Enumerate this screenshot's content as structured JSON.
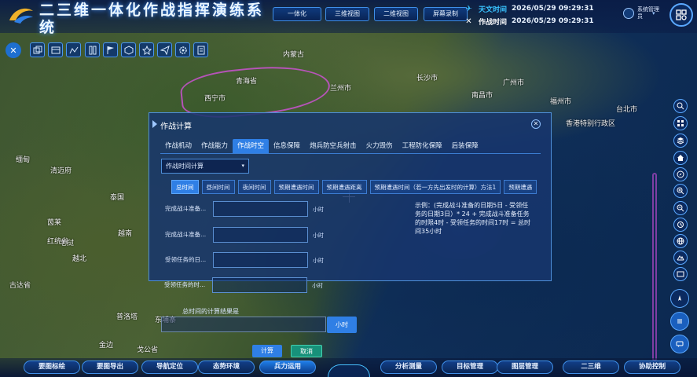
{
  "app": {
    "title": "二三维一体化作战指挥演练系统"
  },
  "top_nav": [
    {
      "label": "一体化"
    },
    {
      "label": "三维视图"
    },
    {
      "label": "二维视图"
    },
    {
      "label": "屏幕录制"
    }
  ],
  "times": {
    "astro_label": "天文时间",
    "astro_value": "2026/05/29 09:29:31",
    "op_label": "作战时间",
    "op_value": "2026/05/29 09:29:31"
  },
  "user": {
    "name": "系统管理员"
  },
  "map_labels": [
    "青海省",
    "内蒙古",
    "西宁市",
    "兰州市",
    "长沙市",
    "南昌市",
    "广州市",
    "福州市",
    "台北市",
    "香港特别行政区",
    "泰国",
    "清迈府",
    "老挝",
    "越南",
    "越北",
    "缅甸",
    "东埔寨",
    "金边",
    "戈公省",
    "茵莱",
    "红统省",
    "普洛塔",
    "古达省"
  ],
  "dialog": {
    "title": "作战计算",
    "tabs": [
      "作战机动",
      "作战能力",
      "作战时空",
      "信息保障",
      "炮兵防空兵射击",
      "火力毁伤",
      "工程防化保障",
      "后装保障"
    ],
    "active_tab": "作战时空",
    "select_value": "作战时间计算",
    "subtabs": [
      "总时间",
      "昼间时间",
      "夜间时间",
      "预期遭遇时间",
      "预期遭遇距离",
      "预期遭遇时间（若一方先出发时的计算）方法1",
      "预期遭遇"
    ],
    "active_subtab": "总时间",
    "fields": [
      {
        "label": "完成战斗准备...",
        "unit": "小时"
      },
      {
        "label": "完成战斗准备...",
        "unit": "小时"
      },
      {
        "label": "受领任务的日...",
        "unit": "小时"
      },
      {
        "label": "受领任务的时...",
        "unit": "小时"
      }
    ],
    "example": "示例：(完成战斗准备的日期5日 - 受领任务的日期3日）* 24 + 完成战斗准备任务的时限4时 - 受领任务的时间17时 = 总时间35小时"
  },
  "result": {
    "label": "总时间的计算结果是",
    "unit_button": "小时",
    "calc_button": "计算",
    "cancel_button": "取消"
  },
  "bottom_nav": [
    {
      "label": "要图标绘"
    },
    {
      "label": "要图导出"
    },
    {
      "label": "导航定位"
    },
    {
      "label": "态势环境"
    },
    {
      "label": "兵力运用"
    },
    {
      "label": "分析测量"
    },
    {
      "label": "目标管理"
    },
    {
      "label": "图层管理"
    },
    {
      "label": "二三维"
    },
    {
      "label": "协助控制"
    }
  ],
  "active_bottom": "兵力运用",
  "colors": {
    "accent": "#2f7fe5",
    "astro_time": "#39c3ff",
    "op_time": "#ffffff",
    "cancel": "#17917a"
  }
}
